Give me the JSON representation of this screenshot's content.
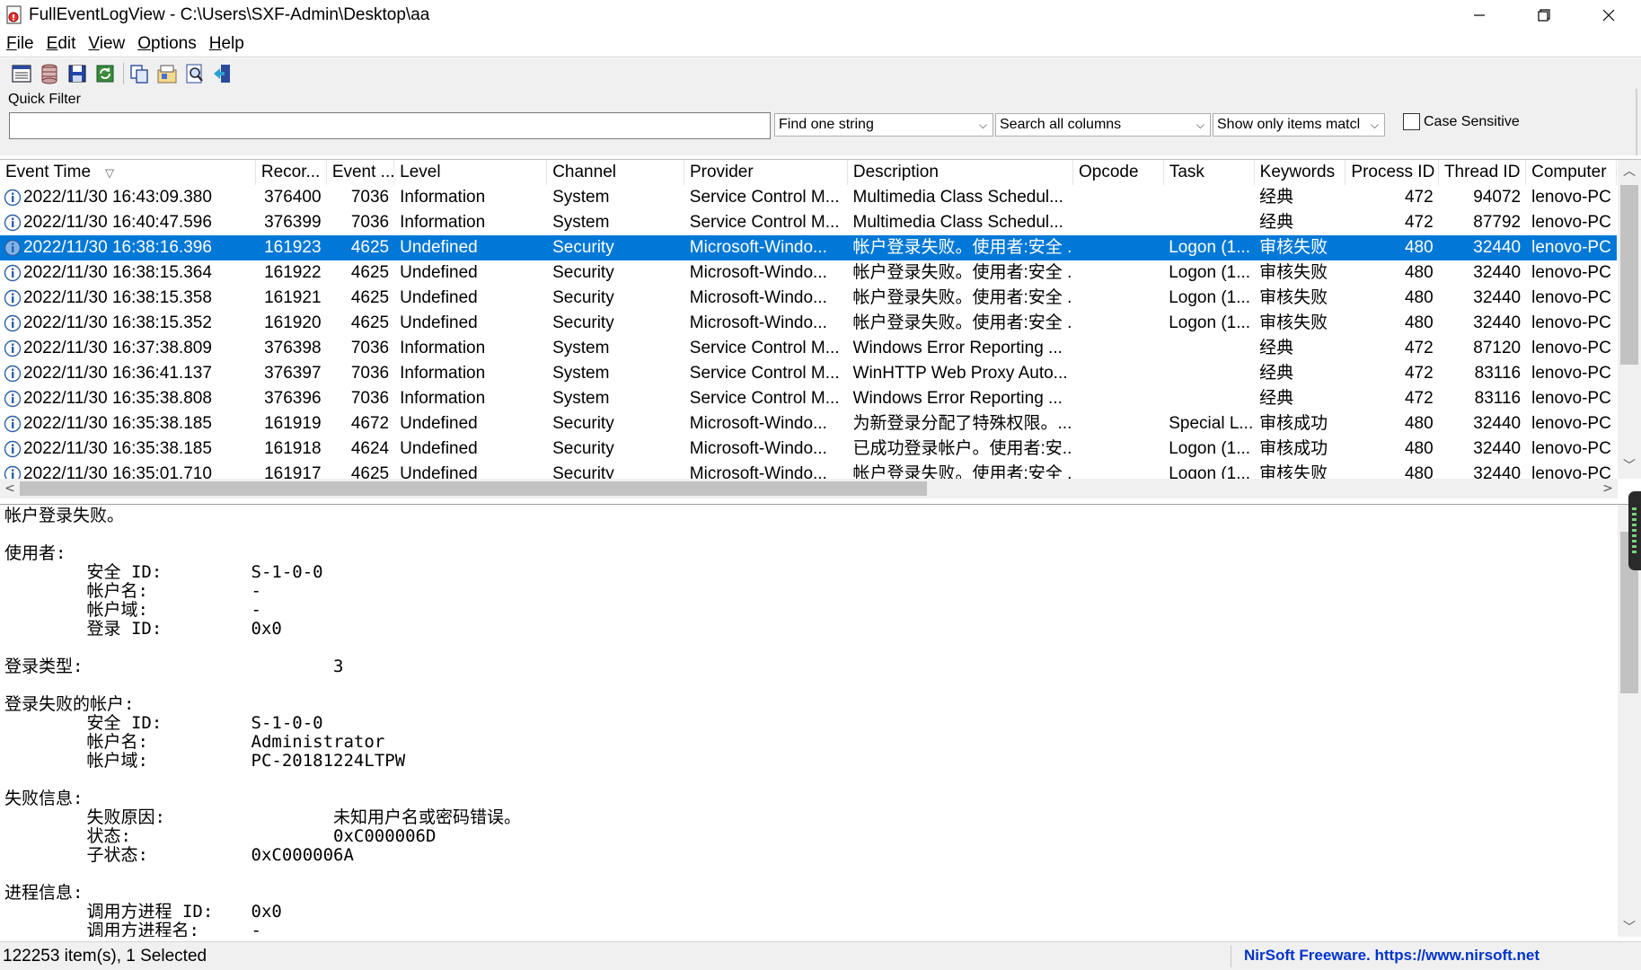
{
  "window": {
    "title": "FullEventLogView - C:\\Users\\SXF-Admin\\Desktop\\aa",
    "minimize_icon": "minimize-icon",
    "maximize_icon": "restore-icon",
    "close_icon": "close-icon"
  },
  "menu": [
    {
      "label": "File",
      "u": "F",
      "rest": "ile"
    },
    {
      "label": "Edit",
      "u": "E",
      "rest": "dit"
    },
    {
      "label": "View",
      "u": "V",
      "rest": "iew"
    },
    {
      "label": "Options",
      "u": "O",
      "rest": "ptions"
    },
    {
      "label": "Help",
      "u": "H",
      "rest": "elp"
    }
  ],
  "toolbar": {
    "icons": [
      "choose-source-icon",
      "event-log-icon",
      "save-icon",
      "refresh-icon",
      "copy-icon",
      "properties-icon",
      "find-icon",
      "exit-icon"
    ]
  },
  "quick_filter": {
    "label": "Quick Filter",
    "input_value": "",
    "find_mode": "Find one string",
    "column_mode": "Search all columns",
    "show_mode": "Show only items matcl",
    "case_sensitive_label": "Case Sensitive",
    "case_sensitive_checked": false
  },
  "table": {
    "columns": [
      "Event Time",
      "Recor...",
      "Event ...",
      "Level",
      "Channel",
      "Provider",
      "Description",
      "Opcode",
      "Task",
      "Keywords",
      "Process ID",
      "Thread ID",
      "Computer"
    ],
    "sort_indicator": "▽",
    "rows": [
      {
        "time": "2022/11/30 16:43:09.380",
        "record": "376400",
        "event": "7036",
        "level": "Information",
        "channel": "System",
        "provider": "Service Control M...",
        "description": "Multimedia Class Schedul...",
        "opcode": "",
        "task": "",
        "keywords": "经典",
        "pid": "472",
        "tid": "94072",
        "computer": "lenovo-PC",
        "selected": false
      },
      {
        "time": "2022/11/30 16:40:47.596",
        "record": "376399",
        "event": "7036",
        "level": "Information",
        "channel": "System",
        "provider": "Service Control M...",
        "description": "Multimedia Class Schedul...",
        "opcode": "",
        "task": "",
        "keywords": "经典",
        "pid": "472",
        "tid": "87792",
        "computer": "lenovo-PC",
        "selected": false
      },
      {
        "time": "2022/11/30 16:38:16.396",
        "record": "161923",
        "event": "4625",
        "level": "Undefined",
        "channel": "Security",
        "provider": "Microsoft-Windo...",
        "description": "帐户登录失败。使用者:安全 ...",
        "opcode": "",
        "task": "Logon (1...",
        "keywords": "审核失败",
        "pid": "480",
        "tid": "32440",
        "computer": "lenovo-PC",
        "selected": true
      },
      {
        "time": "2022/11/30 16:38:15.364",
        "record": "161922",
        "event": "4625",
        "level": "Undefined",
        "channel": "Security",
        "provider": "Microsoft-Windo...",
        "description": "帐户登录失败。使用者:安全 ...",
        "opcode": "",
        "task": "Logon (1...",
        "keywords": "审核失败",
        "pid": "480",
        "tid": "32440",
        "computer": "lenovo-PC",
        "selected": false
      },
      {
        "time": "2022/11/30 16:38:15.358",
        "record": "161921",
        "event": "4625",
        "level": "Undefined",
        "channel": "Security",
        "provider": "Microsoft-Windo...",
        "description": "帐户登录失败。使用者:安全 ...",
        "opcode": "",
        "task": "Logon (1...",
        "keywords": "审核失败",
        "pid": "480",
        "tid": "32440",
        "computer": "lenovo-PC",
        "selected": false
      },
      {
        "time": "2022/11/30 16:38:15.352",
        "record": "161920",
        "event": "4625",
        "level": "Undefined",
        "channel": "Security",
        "provider": "Microsoft-Windo...",
        "description": "帐户登录失败。使用者:安全 ...",
        "opcode": "",
        "task": "Logon (1...",
        "keywords": "审核失败",
        "pid": "480",
        "tid": "32440",
        "computer": "lenovo-PC",
        "selected": false
      },
      {
        "time": "2022/11/30 16:37:38.809",
        "record": "376398",
        "event": "7036",
        "level": "Information",
        "channel": "System",
        "provider": "Service Control M...",
        "description": "Windows Error Reporting ...",
        "opcode": "",
        "task": "",
        "keywords": "经典",
        "pid": "472",
        "tid": "87120",
        "computer": "lenovo-PC",
        "selected": false
      },
      {
        "time": "2022/11/30 16:36:41.137",
        "record": "376397",
        "event": "7036",
        "level": "Information",
        "channel": "System",
        "provider": "Service Control M...",
        "description": "WinHTTP Web Proxy Auto...",
        "opcode": "",
        "task": "",
        "keywords": "经典",
        "pid": "472",
        "tid": "83116",
        "computer": "lenovo-PC",
        "selected": false
      },
      {
        "time": "2022/11/30 16:35:38.808",
        "record": "376396",
        "event": "7036",
        "level": "Information",
        "channel": "System",
        "provider": "Service Control M...",
        "description": "Windows Error Reporting ...",
        "opcode": "",
        "task": "",
        "keywords": "经典",
        "pid": "472",
        "tid": "83116",
        "computer": "lenovo-PC",
        "selected": false
      },
      {
        "time": "2022/11/30 16:35:38.185",
        "record": "161919",
        "event": "4672",
        "level": "Undefined",
        "channel": "Security",
        "provider": "Microsoft-Windo...",
        "description": "为新登录分配了特殊权限。...",
        "opcode": "",
        "task": "Special L...",
        "keywords": "审核成功",
        "pid": "480",
        "tid": "32440",
        "computer": "lenovo-PC",
        "selected": false
      },
      {
        "time": "2022/11/30 16:35:38.185",
        "record": "161918",
        "event": "4624",
        "level": "Undefined",
        "channel": "Security",
        "provider": "Microsoft-Windo...",
        "description": "已成功登录帐户。使用者:安...",
        "opcode": "",
        "task": "Logon (1...",
        "keywords": "审核成功",
        "pid": "480",
        "tid": "32440",
        "computer": "lenovo-PC",
        "selected": false
      },
      {
        "time": "2022/11/30 16:35:01.710",
        "record": "161917",
        "event": "4625",
        "level": "Undefined",
        "channel": "Security",
        "provider": "Microsoft-Windo...",
        "description": "帐户登录失败。使用者:安全 ...",
        "opcode": "",
        "task": "Logon (1...",
        "keywords": "审核失败",
        "pid": "480",
        "tid": "32440",
        "computer": "lenovo-PC",
        "selected": false
      }
    ]
  },
  "detail": {
    "text": "帐户登录失败。\n\n使用者:\n\t安全 ID:\t\tS-1-0-0\n\t帐户名:\t\t-\n\t帐户域:\t\t-\n\t登录 ID:\t\t0x0\n\n登录类型:\t\t\t3\n\n登录失败的帐户:\n\t安全 ID:\t\tS-1-0-0\n\t帐户名:\t\tAdministrator\n\t帐户域:\t\tPC-20181224LTPW\n\n失败信息:\n\t失败原因:\t\t未知用户名或密码错误。\n\t状态:\t\t\t0xC000006D\n\t子状态:\t\t0xC000006A\n\n进程信息:\n\t调用方进程 ID:\t0x0\n\t调用方进程名:\t-"
  },
  "status": {
    "items": "122253 item(s), 1 Selected",
    "link": "NirSoft Freeware. https://www.nirsoft.net"
  },
  "colors": {
    "selection": "#0078d7",
    "link": "#0033cc",
    "chrome": "#f0f0f0"
  }
}
